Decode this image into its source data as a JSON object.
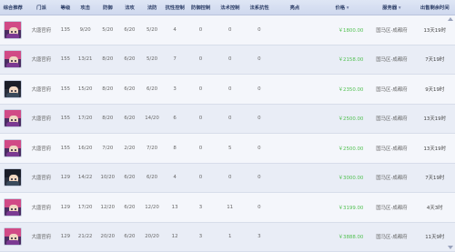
{
  "headers": [
    "综合推荐",
    "门派",
    "等级",
    "攻击",
    "防御",
    "法攻",
    "法防",
    "抗性控制",
    "防御控制",
    "法术控制",
    "法系抗性",
    "亮点",
    "价格",
    "服务器",
    "出售剩余时间"
  ],
  "sortable": [
    false,
    false,
    false,
    false,
    false,
    false,
    false,
    false,
    false,
    false,
    false,
    false,
    true,
    true,
    false
  ],
  "rows": [
    {
      "avatar": "purple",
      "sect": "大唐官府",
      "level": "135",
      "c3": "9/20",
      "c4": "5/20",
      "c5": "6/20",
      "c6": "5/20",
      "c7": "4",
      "c8": "0",
      "c9": "0",
      "c10": "0",
      "c11": "",
      "price": "￥1800.00",
      "server": "国马区-成都府",
      "time": "13天19时"
    },
    {
      "avatar": "purple",
      "sect": "大唐官府",
      "level": "155",
      "c3": "13/21",
      "c4": "8/20",
      "c5": "6/20",
      "c6": "5/20",
      "c7": "7",
      "c8": "0",
      "c9": "0",
      "c10": "0",
      "c11": "",
      "price": "￥2158.00",
      "server": "国马区-成都府",
      "time": "7天19时"
    },
    {
      "avatar": "dark",
      "sect": "大唐官府",
      "level": "155",
      "c3": "15/20",
      "c4": "8/20",
      "c5": "6/20",
      "c6": "6/20",
      "c7": "3",
      "c8": "0",
      "c9": "0",
      "c10": "0",
      "c11": "",
      "price": "￥2350.00",
      "server": "国马区-成都府",
      "time": "9天19时"
    },
    {
      "avatar": "purple",
      "sect": "大唐官府",
      "level": "155",
      "c3": "17/20",
      "c4": "8/20",
      "c5": "6/20",
      "c6": "14/20",
      "c7": "6",
      "c8": "0",
      "c9": "0",
      "c10": "0",
      "c11": "",
      "price": "￥2500.00",
      "server": "国马区-成都府",
      "time": "13天19时"
    },
    {
      "avatar": "purple",
      "sect": "大唐官府",
      "level": "155",
      "c3": "16/20",
      "c4": "7/20",
      "c5": "2/20",
      "c6": "7/20",
      "c7": "8",
      "c8": "0",
      "c9": "5",
      "c10": "0",
      "c11": "",
      "price": "￥2500.00",
      "server": "国马区-成都府",
      "time": "13天19时"
    },
    {
      "avatar": "dark",
      "sect": "大唐官府",
      "level": "129",
      "c3": "14/22",
      "c4": "10/20",
      "c5": "6/20",
      "c6": "6/20",
      "c7": "4",
      "c8": "0",
      "c9": "0",
      "c10": "0",
      "c11": "",
      "price": "￥3000.00",
      "server": "国马区-成都府",
      "time": "7天19时"
    },
    {
      "avatar": "purple",
      "sect": "大唐官府",
      "level": "129",
      "c3": "17/20",
      "c4": "12/20",
      "c5": "6/20",
      "c6": "12/20",
      "c7": "13",
      "c8": "3",
      "c9": "11",
      "c10": "0",
      "c11": "",
      "price": "￥3199.00",
      "server": "国马区-成都府",
      "time": "4天3时"
    },
    {
      "avatar": "purple",
      "sect": "大唐官府",
      "level": "129",
      "c3": "21/22",
      "c4": "20/20",
      "c5": "6/20",
      "c6": "20/20",
      "c7": "12",
      "c8": "3",
      "c9": "1",
      "c10": "3",
      "c11": "",
      "price": "￥3888.00",
      "server": "国马区-成都府",
      "time": "11天9时"
    }
  ]
}
